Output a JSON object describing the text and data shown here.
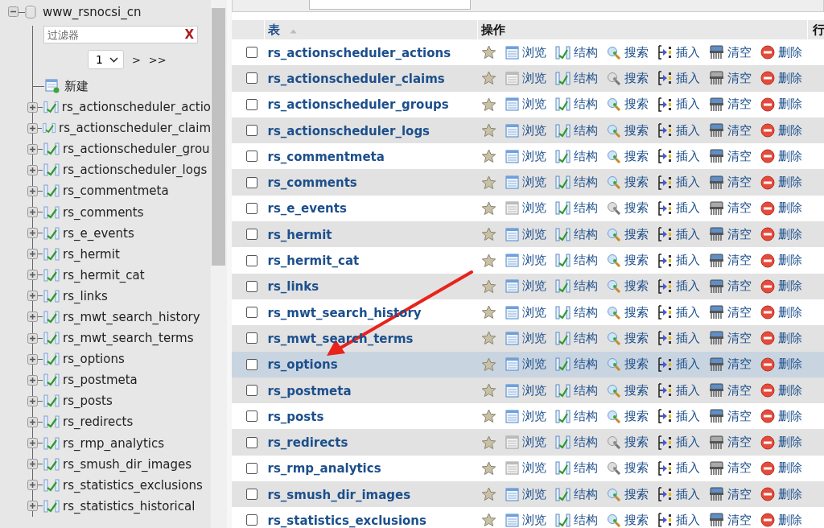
{
  "sidebar": {
    "database": {
      "name": "www_rsnocsi_cn",
      "expanded": true
    },
    "filter": {
      "placeholder": "过滤器",
      "clear": "X"
    },
    "pager": {
      "page": "1",
      "next": ">",
      "last": ">>"
    },
    "new_item": "新建",
    "tables": [
      "rs_actionscheduler_actio",
      "rs_actionscheduler_claim",
      "rs_actionscheduler_grou",
      "rs_actionscheduler_logs",
      "rs_commentmeta",
      "rs_comments",
      "rs_e_events",
      "rs_hermit",
      "rs_hermit_cat",
      "rs_links",
      "rs_mwt_search_history",
      "rs_mwt_search_terms",
      "rs_options",
      "rs_postmeta",
      "rs_posts",
      "rs_redirects",
      "rs_rmp_analytics",
      "rs_smush_dir_images",
      "rs_statistics_exclusions",
      "rs_statistics_historical"
    ]
  },
  "table": {
    "columns": [
      "表",
      "操作",
      "行"
    ],
    "rows": [
      {
        "name": "rs_actionscheduler_actions",
        "highlighted": false,
        "empty": false,
        "actions": [
          "浏览",
          "结构",
          "搜索",
          "插入",
          "清空",
          "删除"
        ]
      },
      {
        "name": "rs_actionscheduler_claims",
        "highlighted": false,
        "empty": true,
        "actions": [
          "浏览",
          "结构",
          "搜索",
          "插入",
          "清空",
          "删除"
        ]
      },
      {
        "name": "rs_actionscheduler_groups",
        "highlighted": false,
        "empty": false,
        "actions": [
          "浏览",
          "结构",
          "搜索",
          "插入",
          "清空",
          "删除"
        ]
      },
      {
        "name": "rs_actionscheduler_logs",
        "highlighted": false,
        "empty": false,
        "actions": [
          "浏览",
          "结构",
          "搜索",
          "插入",
          "清空",
          "删除"
        ]
      },
      {
        "name": "rs_commentmeta",
        "highlighted": false,
        "empty": false,
        "actions": [
          "浏览",
          "结构",
          "搜索",
          "插入",
          "清空",
          "删除"
        ]
      },
      {
        "name": "rs_comments",
        "highlighted": false,
        "empty": false,
        "actions": [
          "浏览",
          "结构",
          "搜索",
          "插入",
          "清空",
          "删除"
        ]
      },
      {
        "name": "rs_e_events",
        "highlighted": false,
        "empty": true,
        "actions": [
          "浏览",
          "结构",
          "搜索",
          "插入",
          "清空",
          "删除"
        ]
      },
      {
        "name": "rs_hermit",
        "highlighted": false,
        "empty": false,
        "actions": [
          "浏览",
          "结构",
          "搜索",
          "插入",
          "清空",
          "删除"
        ]
      },
      {
        "name": "rs_hermit_cat",
        "highlighted": false,
        "empty": false,
        "actions": [
          "浏览",
          "结构",
          "搜索",
          "插入",
          "清空",
          "删除"
        ]
      },
      {
        "name": "rs_links",
        "highlighted": false,
        "empty": false,
        "actions": [
          "浏览",
          "结构",
          "搜索",
          "插入",
          "清空",
          "删除"
        ]
      },
      {
        "name": "rs_mwt_search_history",
        "highlighted": false,
        "empty": false,
        "actions": [
          "浏览",
          "结构",
          "搜索",
          "插入",
          "清空",
          "删除"
        ]
      },
      {
        "name": "rs_mwt_search_terms",
        "highlighted": false,
        "empty": false,
        "actions": [
          "浏览",
          "结构",
          "搜索",
          "插入",
          "清空",
          "删除"
        ]
      },
      {
        "name": "rs_options",
        "highlighted": true,
        "empty": false,
        "actions": [
          "浏览",
          "结构",
          "搜索",
          "插入",
          "清空",
          "删除"
        ]
      },
      {
        "name": "rs_postmeta",
        "highlighted": false,
        "empty": false,
        "actions": [
          "浏览",
          "结构",
          "搜索",
          "插入",
          "清空",
          "删除"
        ]
      },
      {
        "name": "rs_posts",
        "highlighted": false,
        "empty": false,
        "actions": [
          "浏览",
          "结构",
          "搜索",
          "插入",
          "清空",
          "删除"
        ]
      },
      {
        "name": "rs_redirects",
        "highlighted": false,
        "empty": true,
        "actions": [
          "浏览",
          "结构",
          "搜索",
          "插入",
          "清空",
          "删除"
        ]
      },
      {
        "name": "rs_rmp_analytics",
        "highlighted": false,
        "empty": true,
        "actions": [
          "浏览",
          "结构",
          "搜索",
          "插入",
          "清空",
          "删除"
        ]
      },
      {
        "name": "rs_smush_dir_images",
        "highlighted": false,
        "empty": false,
        "actions": [
          "浏览",
          "结构",
          "搜索",
          "插入",
          "清空",
          "删除"
        ]
      },
      {
        "name": "rs_statistics_exclusions",
        "highlighted": false,
        "empty": false,
        "actions": [
          "浏览",
          "结构",
          "搜索",
          "插入",
          "清空",
          "删除"
        ]
      }
    ]
  }
}
